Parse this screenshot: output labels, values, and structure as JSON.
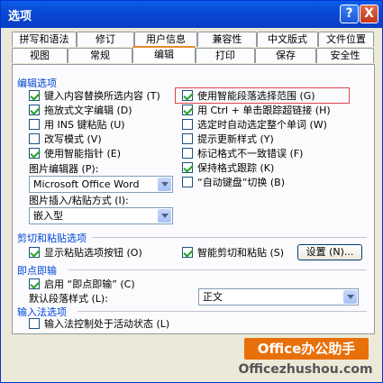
{
  "window": {
    "title": "选项",
    "help_label": "?",
    "close_label": "X"
  },
  "tabs": {
    "row1": [
      {
        "label": "拼写和语法"
      },
      {
        "label": "修订"
      },
      {
        "label": "用户信息"
      },
      {
        "label": "兼容性"
      },
      {
        "label": "中文版式"
      },
      {
        "label": "文件位置"
      }
    ],
    "row2": [
      {
        "label": "视图"
      },
      {
        "label": "常规"
      },
      {
        "label": "编辑",
        "active": true
      },
      {
        "label": "打印"
      },
      {
        "label": "保存"
      },
      {
        "label": "安全性"
      }
    ]
  },
  "edit_options": {
    "heading": "编辑选项",
    "left": [
      {
        "label": "键入内容替换所选内容 (T)",
        "checked": true
      },
      {
        "label": "拖放式文字编辑 (D)",
        "checked": true
      },
      {
        "label": "用 INS 键粘贴 (U)",
        "checked": false
      },
      {
        "label": "改写模式 (V)",
        "checked": false
      },
      {
        "label": "使用智能指针 (E)",
        "checked": true
      }
    ],
    "right": [
      {
        "label": "使用智能段落选择范围 (G)",
        "checked": true
      },
      {
        "label": "用 Ctrl + 单击跟踪超链接 (H)",
        "checked": true
      },
      {
        "label": "选定时自动选定整个单词 (W)",
        "checked": false
      },
      {
        "label": "提示更新样式 (Y)",
        "checked": false
      },
      {
        "label": "标记格式不一致错误 (F)",
        "checked": false
      },
      {
        "label": "保持格式跟踪 (K)",
        "checked": true
      },
      {
        "label": "“自动键盘”切换 (B)",
        "checked": false
      }
    ],
    "picture_editor_label": "图片编辑器 (P):",
    "picture_editor_value": "Microsoft Office Word",
    "insert_paste_label": "图片插入/粘贴方式 (I):",
    "insert_paste_value": "嵌入型"
  },
  "cut_paste": {
    "heading": "剪切和粘贴选项",
    "show_paste_buttons": {
      "label": "显示粘贴选项按钮 (O)",
      "checked": true
    },
    "smart_cut_paste": {
      "label": "智能剪切和粘贴 (S)",
      "checked": true
    },
    "settings_button": "设置 (N)..."
  },
  "click_type": {
    "heading": "即点即输",
    "enable": {
      "label": "启用 “即点即输” (C)",
      "checked": true
    },
    "default_style_label": "默认段落样式 (L):",
    "default_style_value": "正文"
  },
  "ime": {
    "heading": "输入法选项",
    "ime_control": {
      "label": "输入法控制处于活动状态 (L)",
      "checked": false
    }
  },
  "watermark": {
    "brand": "Office办公助手",
    "site": "Officezhushou.com"
  }
}
